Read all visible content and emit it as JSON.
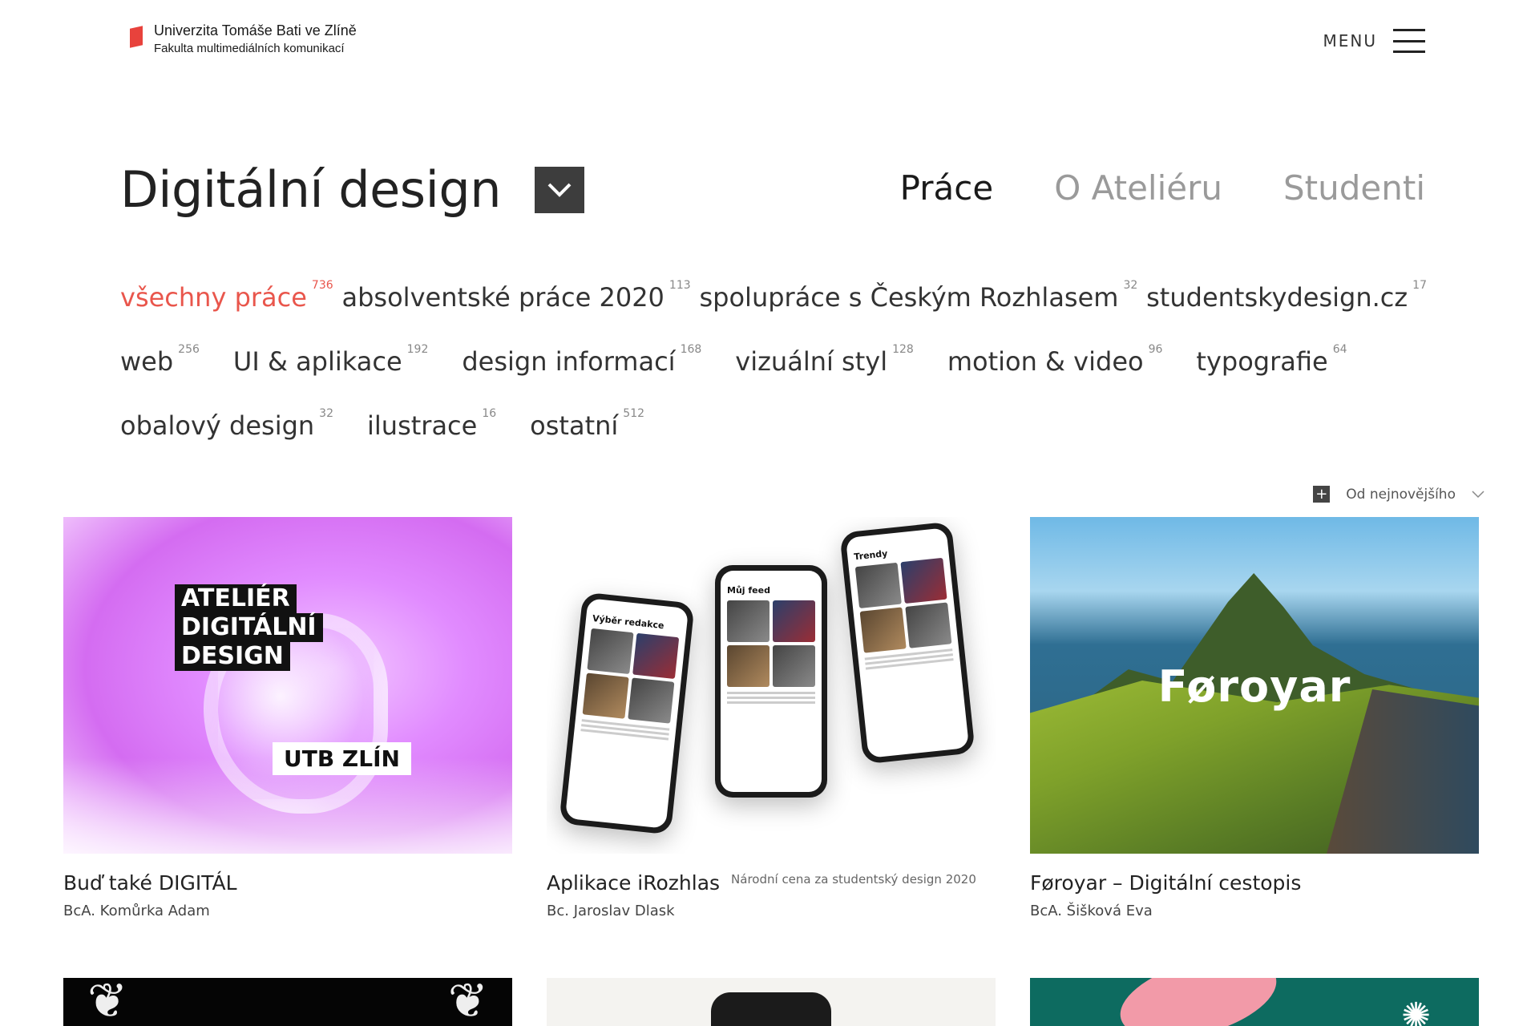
{
  "header": {
    "logo_line1": "Univerzita Tomáše Bati ve Zlíně",
    "logo_line2": "Fakulta multimediálních komunikací",
    "menu_label": "MENU"
  },
  "page": {
    "title": "Digitální design"
  },
  "tabs": [
    {
      "label": "Práce",
      "active": true
    },
    {
      "label": "O Ateliéru",
      "active": false
    },
    {
      "label": "Studenti",
      "active": false
    }
  ],
  "filters": [
    {
      "label": "všechny práce",
      "count": "736",
      "active": true
    },
    {
      "label": "absolventské práce 2020",
      "count": "113"
    },
    {
      "label": "spolupráce s Českým Rozhlasem",
      "count": "32"
    },
    {
      "label": "studentskydesign.cz",
      "count": "17"
    },
    {
      "label": "web",
      "count": "256"
    },
    {
      "label": "UI & aplikace",
      "count": "192"
    },
    {
      "label": "design informací",
      "count": "168"
    },
    {
      "label": "vizuální styl",
      "count": "128"
    },
    {
      "label": "motion & video",
      "count": "96"
    },
    {
      "label": "typografie",
      "count": "64"
    },
    {
      "label": "obalový design",
      "count": "32"
    },
    {
      "label": "ilustrace",
      "count": "16"
    },
    {
      "label": "ostatní",
      "count": "512"
    }
  ],
  "sort": {
    "label": "Od nejnovějšího"
  },
  "cards": [
    {
      "title": "Buď také DIGITÁL",
      "author": "BcA. Komůrka Adam",
      "award": "",
      "thumb_text": [
        "ATELIÉR",
        "DIGITÁLNÍ",
        "DESIGN"
      ],
      "thumb_tag": "UTB ZLÍN"
    },
    {
      "title": "Aplikace iRozhlas",
      "author": "Bc. Jaroslav Dlask",
      "award": "Národní cena za studentský design 2020",
      "phone_titles": [
        "Výběr redakce",
        "Můj feed",
        "Trendy"
      ]
    },
    {
      "title": "Føroyar – Digitální cestopis",
      "author": "BcA. Šišková Eva",
      "award": "",
      "thumb_word": "Føroyar"
    }
  ],
  "colors": {
    "accent": "#e9564c",
    "dark_button": "#3d3d3d",
    "inactive_tab": "#9a9a9a"
  }
}
